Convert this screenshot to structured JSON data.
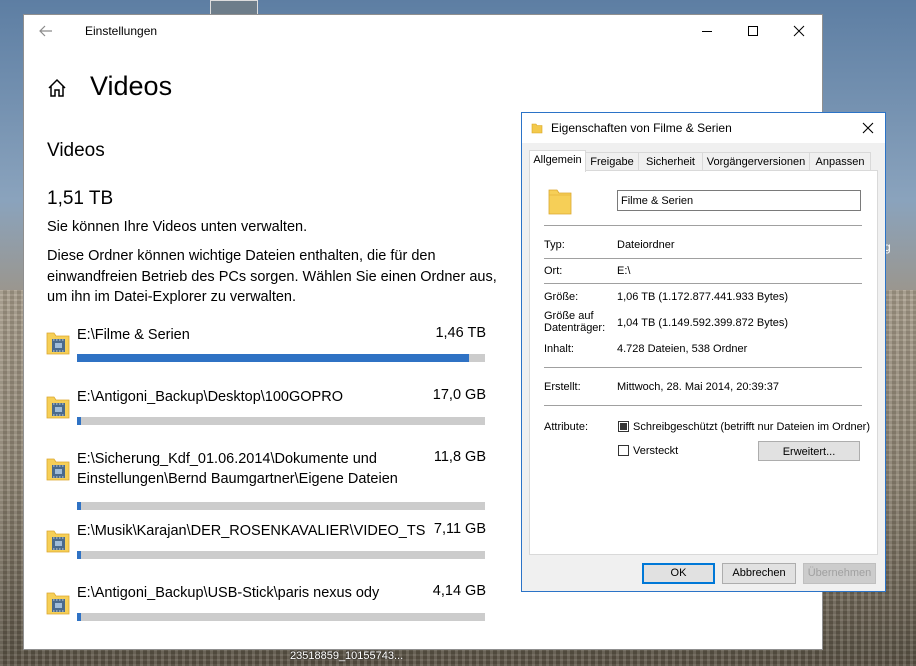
{
  "desktop": {
    "caption": "23518859_10155743...",
    "edge_letter": "g"
  },
  "settings": {
    "app_title": "Einstellungen",
    "page_title": "Videos",
    "section_title": "Videos",
    "total_size": "1,51 TB",
    "description_1": "Sie können Ihre Videos unten verwalten.",
    "description_2": "Diese Ordner können wichtige Dateien enthalten, die für den einwandfreien Betrieb des PCs sorgen. Wählen Sie einen Ordner aus, um ihn im Datei-Explorer zu verwalten.",
    "accent_color": "#2f72c4",
    "folders": [
      {
        "path": "E:\\Filme & Serien",
        "size": "1,46 TB",
        "usage_percent": 96
      },
      {
        "path": "E:\\Antigoni_Backup\\Desktop\\100GOPRO",
        "size": "17,0 GB",
        "usage_percent": 1
      },
      {
        "path": "E:\\Sicherung_Kdf_01.06.2014\\Dokumente und Einstellungen\\Bernd Baumgartner\\Eigene Dateien",
        "size": "11,8 GB",
        "usage_percent": 1
      },
      {
        "path": "E:\\Musik\\Karajan\\DER_ROSENKAVALIER\\VIDEO_TS",
        "size": "7,11 GB",
        "usage_percent": 1
      },
      {
        "path": "E:\\Antigoni_Backup\\USB-Stick\\paris nexus ody",
        "size": "4,14 GB",
        "usage_percent": 1
      }
    ]
  },
  "properties": {
    "title": "Eigenschaften von Filme & Serien",
    "tabs": [
      "Allgemein",
      "Freigabe",
      "Sicherheit",
      "Vorgängerversionen",
      "Anpassen"
    ],
    "active_tab": "Allgemein",
    "name": "Filme & Serien",
    "type_label": "Typ:",
    "type_value": "Dateiordner",
    "location_label": "Ort:",
    "location_value": "E:\\",
    "size_label": "Größe:",
    "size_value": "1,06 TB (1.172.877.441.933 Bytes)",
    "size_on_disk_label": "Größe auf Datenträger:",
    "size_on_disk_value": "1,04 TB (1.149.592.399.872 Bytes)",
    "contents_label": "Inhalt:",
    "contents_value": "4.728 Dateien, 538 Ordner",
    "created_label": "Erstellt:",
    "created_value": "Mittwoch, 28. Mai 2014, 20:39:37",
    "attributes_label": "Attribute:",
    "readonly_label": "Schreibgeschützt (betrifft nur Dateien im Ordner)",
    "readonly_state": "mixed",
    "hidden_label": "Versteckt",
    "hidden_state": "unchecked",
    "advanced_button": "Erweitert...",
    "ok_button": "OK",
    "cancel_button": "Abbrechen",
    "apply_button": "Übernehmen"
  }
}
